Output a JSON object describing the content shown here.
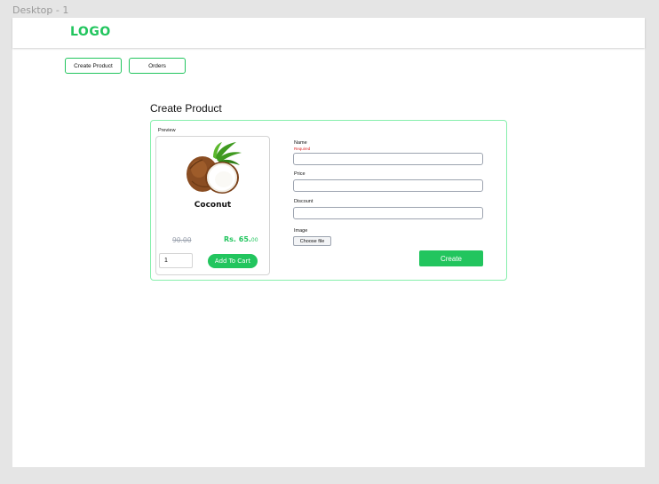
{
  "frame_label": "Desktop - 1",
  "header": {
    "logo": "LOGO"
  },
  "nav": {
    "create_product": "Create Product",
    "orders": "Orders"
  },
  "page": {
    "title": "Create Product"
  },
  "preview": {
    "label": "Preview",
    "product_image_icon": "coconut-image",
    "product_name": "Coconut",
    "old_price": "90.00",
    "new_price_main": "Rs. 65.",
    "new_price_cents": "00",
    "quantity_value": "1",
    "add_to_cart_label": "Add To Cart"
  },
  "form": {
    "name_label": "Name",
    "name_error": "Required",
    "price_label": "Price",
    "discount_label": "Discount",
    "image_label": "Image",
    "choose_file_label": "Choose file",
    "create_label": "Create"
  },
  "colors": {
    "accent": "#22c55e",
    "accent_light": "#86efac",
    "error": "#dc2626",
    "background": "#e5e5e5"
  }
}
